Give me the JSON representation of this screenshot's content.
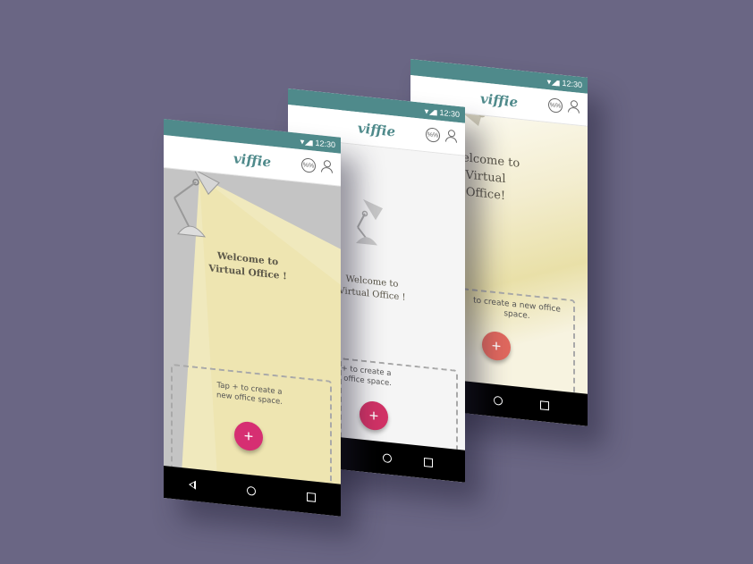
{
  "app": {
    "logo_text": "viffie",
    "status_time": "12:30",
    "wifi_icon_label": "%%",
    "brand_color": "#4f8a8b"
  },
  "screens": [
    {
      "welcome": "Welcome to\nVirtual Office !",
      "tap_text": "Tap + to create a\nnew office space.",
      "fab_label": "+",
      "fab_color": "#d62f72"
    },
    {
      "welcome": "Welcome to\nVirtual Office !",
      "tap_text": "Tap + to create a\nnew office space.",
      "fab_label": "+",
      "fab_color": "#d23266"
    },
    {
      "welcome": "Welcome to\nVirtual\nOffice!",
      "tap_text": "to create a new office\nspace.",
      "fab_label": "+",
      "fab_color": "#e0685e"
    }
  ]
}
